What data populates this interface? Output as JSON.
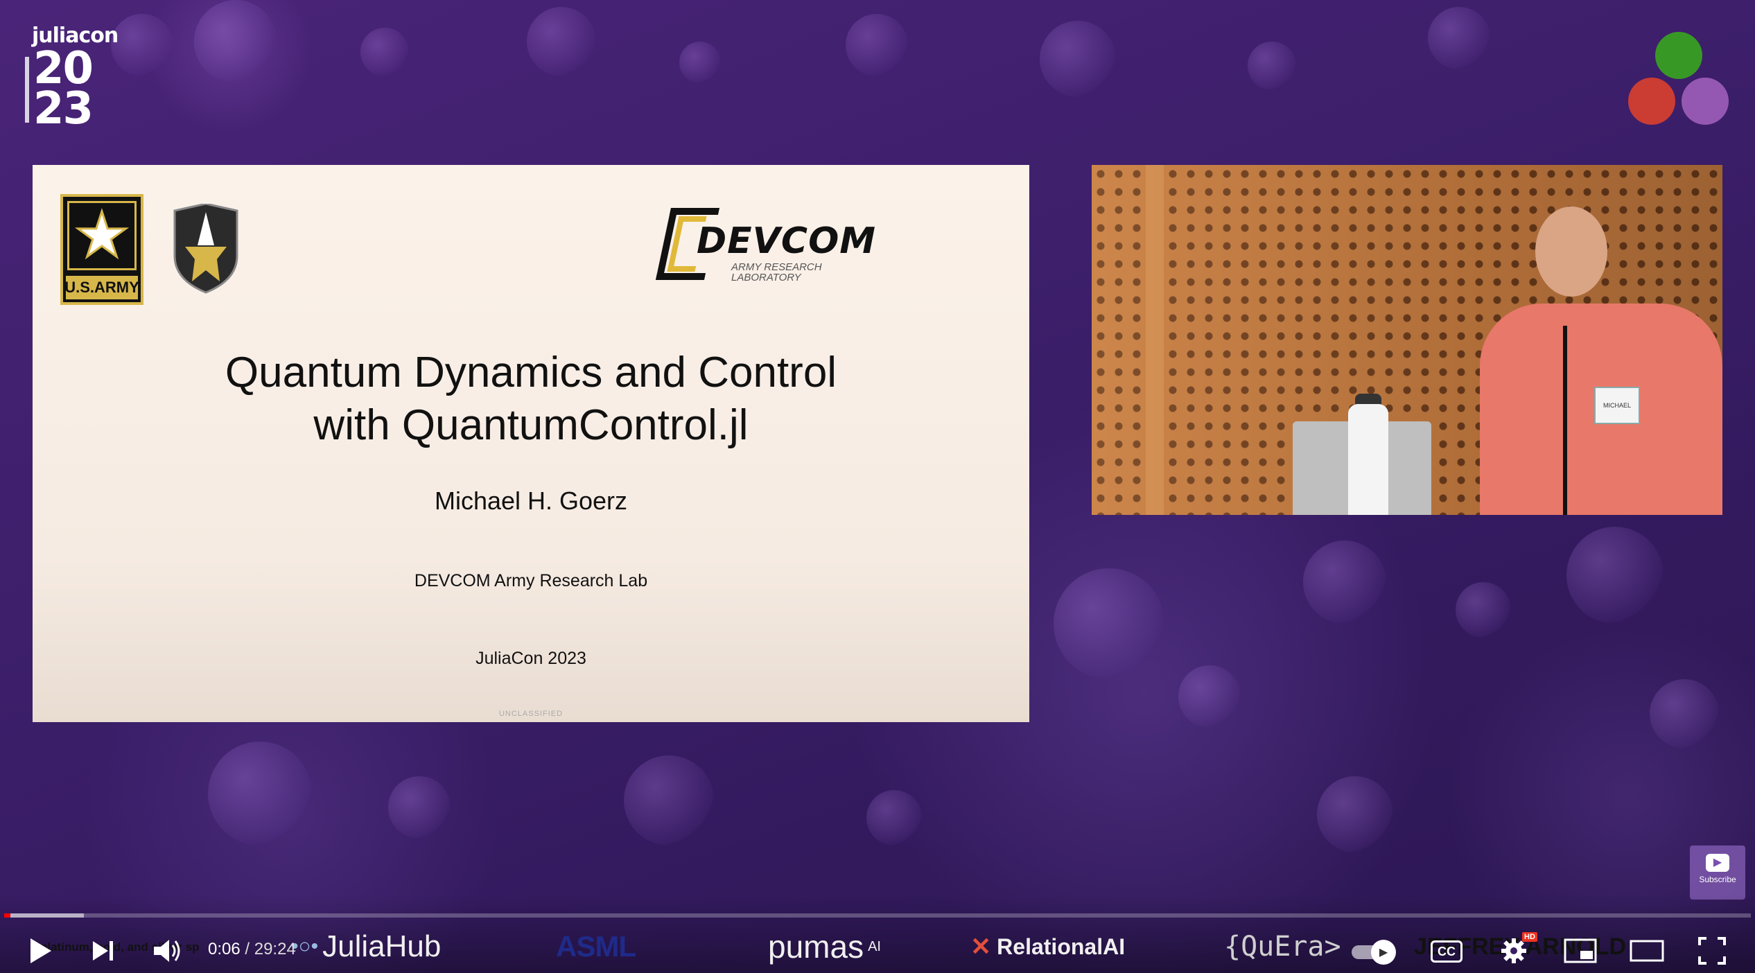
{
  "logo": {
    "name": "juliacon",
    "year_top": "20",
    "year_bottom": "23"
  },
  "julia_dots": {
    "colors": [
      "#389826",
      "#cb3c33",
      "#9558b2"
    ]
  },
  "slide": {
    "army_label": "U.S.ARMY",
    "devcom_word": "DEVCOM",
    "devcom_sub_1": "ARMY RESEARCH",
    "devcom_sub_2": "LABORATORY",
    "title_line_1": "Quantum Dynamics and Control",
    "title_line_2": "with QuantumControl.jl",
    "author": "Michael H. Goerz",
    "affiliation": "DEVCOM Army Research Lab",
    "event": "JuliaCon 2023",
    "classification": "UNCLASSIFIED"
  },
  "speaker_video": {
    "badge_text": "MICHAEL"
  },
  "subscribe": {
    "label": "Subscribe"
  },
  "sponsors": {
    "platinum_text": "platinum, gold, and silver sp",
    "juliahub": "JuliaHub",
    "asml": "ASML",
    "pumas": "pumas",
    "pumas_sup": "AI",
    "relational": "RelationalAI",
    "quera": "{QuEra>",
    "jeffrey": "JEFFREY ARNOLD"
  },
  "player": {
    "current_time": "0:06",
    "separator": " / ",
    "duration": "29:24",
    "progress_fraction": 0.0034,
    "cc_label": "CC",
    "hd_label": "HD",
    "colors": {
      "progress": "#ff0000"
    },
    "icons": [
      "play-icon",
      "next-icon",
      "volume-icon",
      "autoplay-toggle",
      "captions-icon",
      "settings-icon",
      "miniplayer-icon",
      "theater-mode-icon",
      "fullscreen-icon"
    ]
  }
}
